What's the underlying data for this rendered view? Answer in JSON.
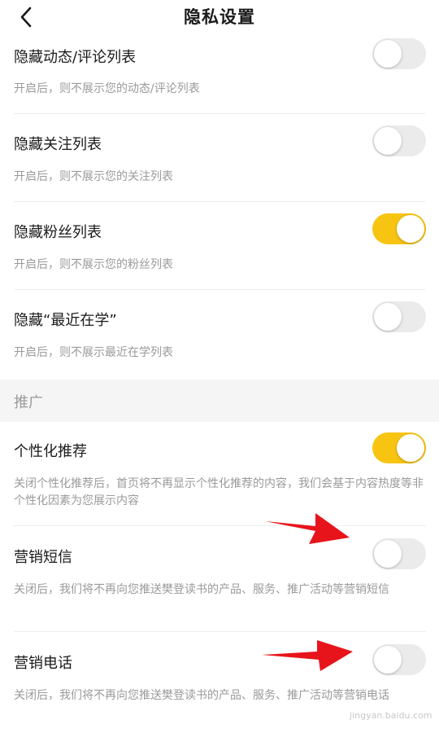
{
  "header": {
    "title": "隐私设置",
    "back_icon": "chevron-left-icon"
  },
  "privacy_items": [
    {
      "label": "隐藏动态/评论列表",
      "desc": "开启后，则不展示您的动态/评论列表",
      "on": false
    },
    {
      "label": "隐藏关注列表",
      "desc": "开启后，则不展示您的关注列表",
      "on": false
    },
    {
      "label": "隐藏粉丝列表",
      "desc": "开启后，则不展示您的粉丝列表",
      "on": true
    },
    {
      "label": "隐藏“最近在学”",
      "desc": "开启后，则不展示最近在学列表",
      "on": false
    }
  ],
  "promo_section": {
    "title": "推广"
  },
  "promo_items": [
    {
      "label": "个性化推荐",
      "desc": "关闭个性化推荐后，首页将不再显示个性化推荐的内容，我们会基于内容热度等非个性化因素为您展示内容",
      "on": true
    },
    {
      "label": "营销短信",
      "desc": "关闭后，我们将不再向您推送樊登读书的产品、服务、推广活动等营销短信",
      "on": false
    },
    {
      "label": "营销电话",
      "desc": "关闭后，我们将不再向您推送樊登读书的产品、服务、推广活动等营销电话",
      "on": false
    }
  ],
  "colors": {
    "toggle_on": "#f7c412",
    "toggle_off": "#ebebeb",
    "arrow": "#e8141b"
  },
  "watermark": "jingyan.baidu.com"
}
